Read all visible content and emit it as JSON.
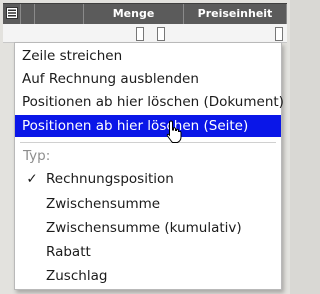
{
  "table": {
    "headers": [
      "",
      "",
      "",
      "Menge",
      "Preiseinheit",
      ""
    ]
  },
  "menu": {
    "items": [
      {
        "label": "Zeile streichen",
        "active": false
      },
      {
        "label": "Auf Rechnung ausblenden",
        "active": false
      },
      {
        "label": "Positionen ab hier löschen (Dokument)",
        "active": false
      },
      {
        "label": "Positionen ab hier löschen (Seite)",
        "active": true
      }
    ],
    "type_label": "Typ:",
    "types": [
      {
        "label": "Rechnungsposition",
        "checked": true,
        "check_mark": "✓"
      },
      {
        "label": "Zwischensumme",
        "checked": false,
        "check_mark": ""
      },
      {
        "label": "Zwischensumme (kumulativ)",
        "checked": false,
        "check_mark": ""
      },
      {
        "label": "Rabatt",
        "checked": false,
        "check_mark": ""
      },
      {
        "label": "Zuschlag",
        "checked": false,
        "check_mark": ""
      }
    ]
  },
  "icons": {
    "row_menu": "row-menu-icon",
    "cursor": "hand-pointer-icon"
  },
  "colors": {
    "header_bg": "#5b5b5b",
    "active_bg": "#0a16e8",
    "muted_text": "#8d8d8d"
  }
}
